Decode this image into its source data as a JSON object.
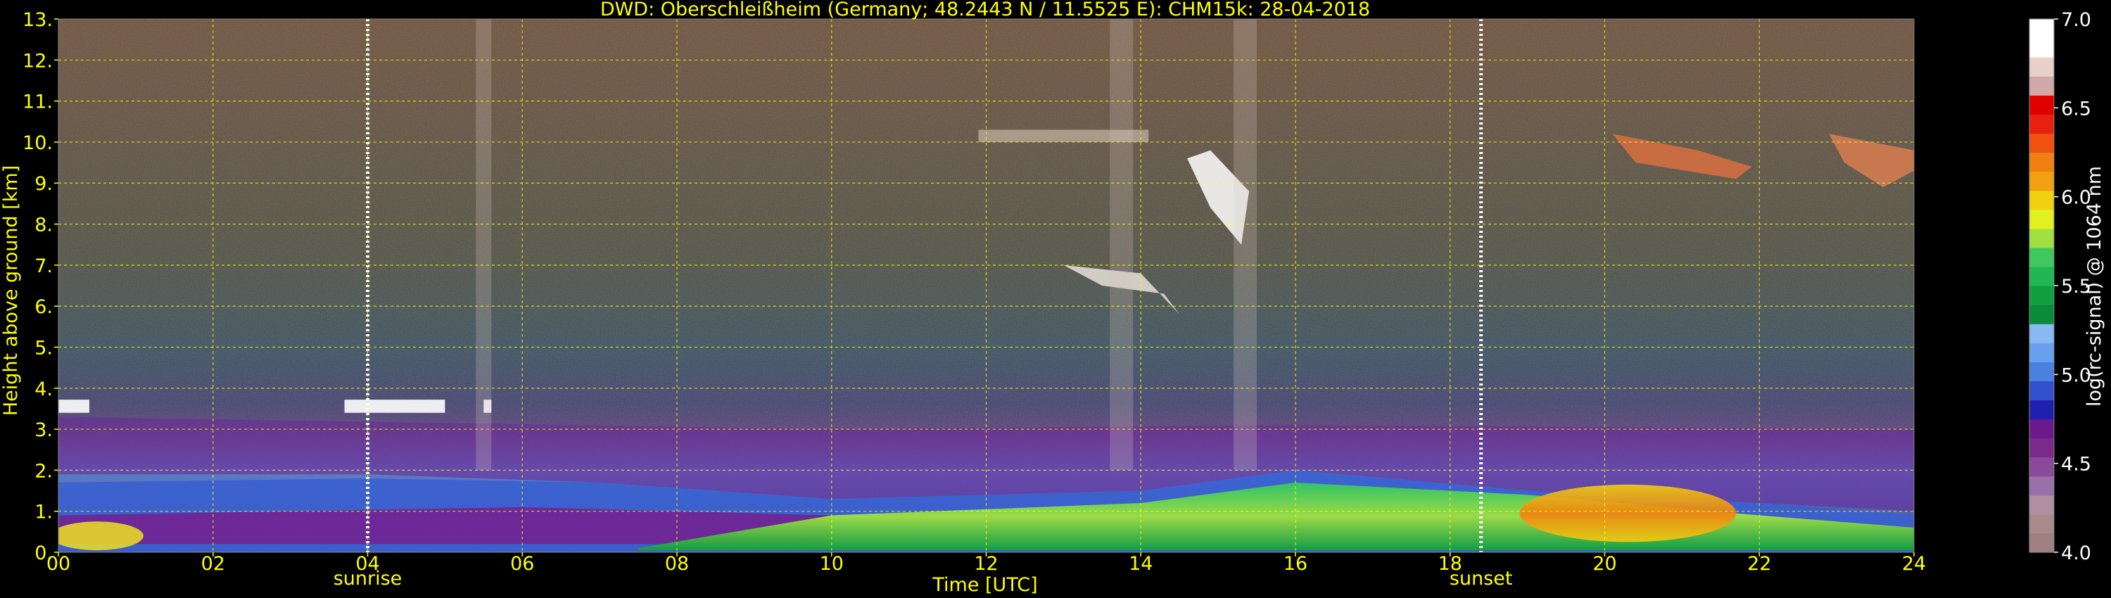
{
  "chart_data": {
    "type": "heatmap",
    "title": "DWD: Oberschleißheim (Germany; 48.2443 N / 11.5525 E):    CHM15k: 28-04-2018",
    "xlabel": "Time [UTC]",
    "ylabel": "Height above ground [km]",
    "xlim": [
      0,
      24
    ],
    "ylim": [
      0,
      13
    ],
    "x_ticks": [
      "00",
      "02",
      "04",
      "06",
      "08",
      "10",
      "12",
      "14",
      "16",
      "18",
      "20",
      "22",
      "24"
    ],
    "y_ticks": [
      "0.",
      "1.",
      "2.",
      "3.",
      "4.",
      "5.",
      "6.",
      "7.",
      "8.",
      "9.",
      "10.",
      "11.",
      "12.",
      "13."
    ],
    "grid": true,
    "markers": [
      {
        "label": "sunrise",
        "time": 4.0
      },
      {
        "label": "sunset",
        "time": 18.4
      }
    ],
    "colorbar": {
      "label": "log(rc-signal) @ 1064 nm",
      "range": [
        4.0,
        7.0
      ],
      "ticks": [
        "4.0",
        "4.5",
        "5.0",
        "5.5",
        "6.0",
        "6.5",
        "7.0"
      ],
      "colors": [
        "#a08080",
        "#a88a8a",
        "#b090a0",
        "#9a70a8",
        "#8a4a9a",
        "#7a2a8a",
        "#6a1a8a",
        "#2020b0",
        "#3050d0",
        "#4a80e0",
        "#6aa0f0",
        "#8ab8f0",
        "#0a8a3a",
        "#10a040",
        "#20b850",
        "#40c860",
        "#a0e040",
        "#e0f020",
        "#f0d010",
        "#f0a010",
        "#f08010",
        "#f05010",
        "#e82010",
        "#e00000",
        "#d0a8a8",
        "#e8d0c8",
        "#ffffff",
        "#ffffff"
      ]
    },
    "features": [
      {
        "name": "boundary layer aerosol",
        "x": [
          0,
          24
        ],
        "y": [
          0,
          2
        ],
        "value": 5.5
      },
      {
        "name": "dense aerosol",
        "x": [
          19,
          21.5
        ],
        "y": [
          0.4,
          1.3
        ],
        "value": 6.0
      },
      {
        "name": "low cloud",
        "x": [
          0,
          5.7
        ],
        "y": [
          3.4,
          3.7
        ],
        "value": 7.0
      },
      {
        "name": "cirrus",
        "x": [
          12.5,
          15.4
        ],
        "y": [
          5.8,
          9.0
        ],
        "value": 7.0
      },
      {
        "name": "cirrus",
        "x": [
          20,
          24
        ],
        "y": [
          8.8,
          10.3
        ],
        "value": 6.0
      }
    ]
  }
}
